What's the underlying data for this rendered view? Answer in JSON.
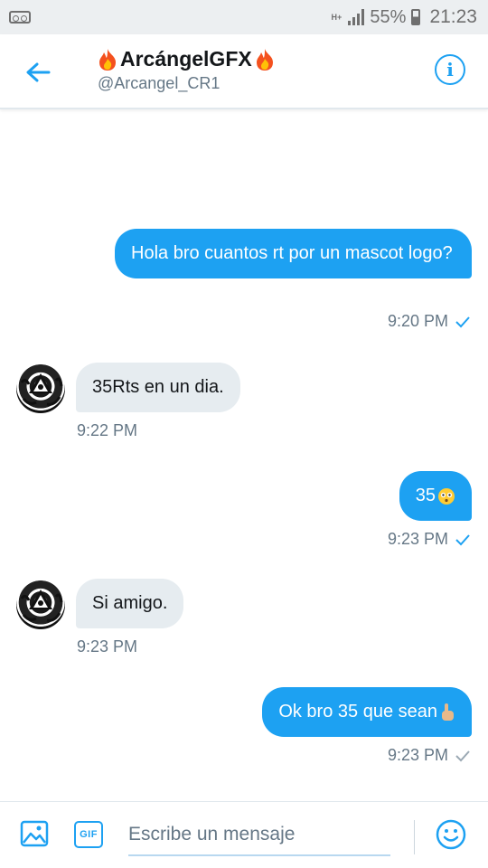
{
  "status_bar": {
    "network": "H+",
    "battery": "55%",
    "time": "21:23"
  },
  "header": {
    "title": "ArcángelGFX",
    "handle": "@Arcangel_CR1"
  },
  "messages": [
    {
      "direction": "sent",
      "text": "Hola bro cuantos rt por un mascot logo?",
      "time": "9:20 PM"
    },
    {
      "direction": "received",
      "text": "35Rts en un dia.",
      "time": "9:22 PM"
    },
    {
      "direction": "sent",
      "text": "35",
      "time": "9:23 PM"
    },
    {
      "direction": "received",
      "text": "Si amigo.",
      "time": "9:23 PM"
    },
    {
      "direction": "sent",
      "text": "Ok bro 35 que sean",
      "time": "9:23 PM"
    }
  ],
  "composer": {
    "gif_label": "GIF",
    "placeholder": "Escribe un mensaje"
  },
  "icons": {
    "back": "arrow-left-icon",
    "info": "info-icon",
    "media": "image-icon",
    "emoji": "smiley-icon",
    "fire": "fire-emoji",
    "read_receipt": "checkmark-icon"
  },
  "colors": {
    "accent": "#1da1f2",
    "received_bubble": "#e6ecf0",
    "secondary_text": "#657786"
  }
}
